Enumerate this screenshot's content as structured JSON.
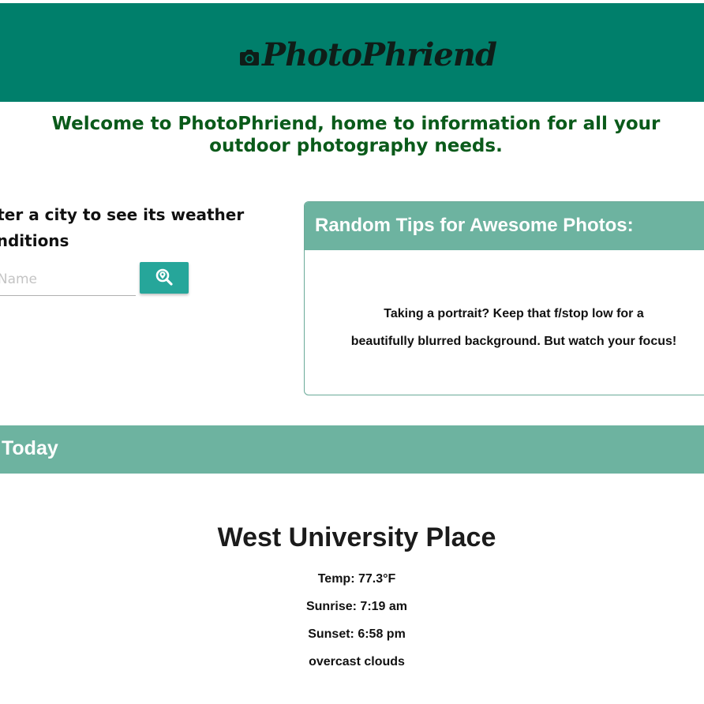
{
  "header": {
    "brand": "PhotoPhriend",
    "brand_icon": "camera-icon",
    "background_color": "#007f6b"
  },
  "welcome": {
    "text": "Welcome to PhotoPhriend, home to information for all your outdoor photography needs."
  },
  "search": {
    "prompt_line1": "nter a city to see its weather",
    "prompt_line2": "onditions",
    "placeholder": "ity Name",
    "button_icon": "search-location-icon",
    "button_color": "#26a69a"
  },
  "tips": {
    "title": "Random Tips for Awesome Photos:",
    "line1": "Taking a portrait? Keep that f/stop low for a",
    "line2": "beautifully blurred background. But watch your focus!",
    "header_color": "#6db3a0"
  },
  "today": {
    "title": "Today"
  },
  "weather": {
    "city": "West University Place",
    "temp": "Temp: 77.3°F",
    "sunrise": "Sunrise: 7:19 am",
    "sunset": "Sunset: 6:58 pm",
    "description": "overcast clouds"
  }
}
